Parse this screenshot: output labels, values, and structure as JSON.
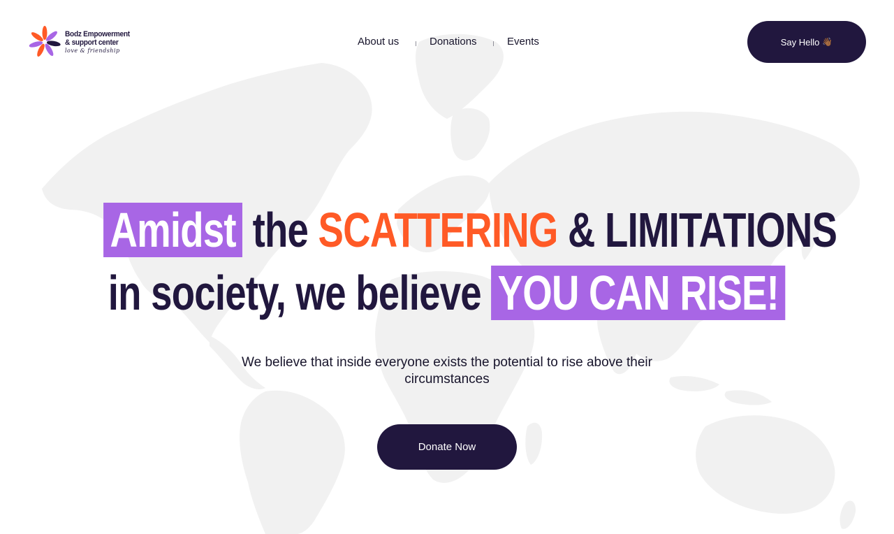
{
  "brand": {
    "line1": "Bodz Empowerment",
    "line2": "& support center",
    "tagline": "love & friendship"
  },
  "nav": {
    "items": [
      {
        "label": "About us"
      },
      {
        "label": "Donations"
      },
      {
        "label": "Events"
      }
    ]
  },
  "header": {
    "cta_label": "Say Hello",
    "cta_icon": "waving-hand-icon",
    "cta_emoji": "👋🏾"
  },
  "hero": {
    "line1": {
      "box": "Amidst",
      "plain1": "the",
      "accent": "SCATTERING",
      "plain2": "& LIMITATIONS"
    },
    "line2": {
      "plain": "in society, we believe",
      "box": "YOU CAN RISE!"
    },
    "subtitle": "We believe that inside everyone exists the potential to rise above their circumstances",
    "button_label": "Donate Now"
  },
  "colors": {
    "navy": "#21173e",
    "purple": "#a866e5",
    "orange": "#ff5a26",
    "map_gray": "#f1f1f1"
  }
}
